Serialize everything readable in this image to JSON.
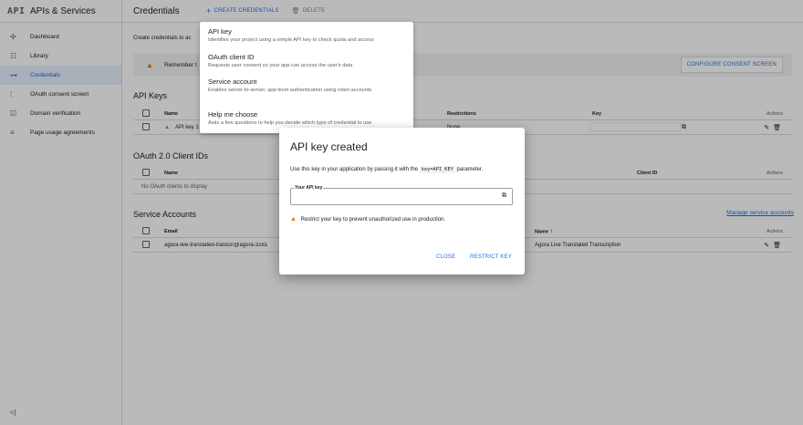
{
  "app": {
    "logo": "API",
    "title": "APIs & Services"
  },
  "sidebar": {
    "items": [
      {
        "label": "Dashboard",
        "icon": "dashboard-icon"
      },
      {
        "label": "Library",
        "icon": "library-icon"
      },
      {
        "label": "Credentials",
        "icon": "key-icon",
        "active": true
      },
      {
        "label": "OAuth consent screen",
        "icon": "consent-icon"
      },
      {
        "label": "Domain verification",
        "icon": "domain-icon"
      },
      {
        "label": "Page usage agreements",
        "icon": "settings-list-icon"
      }
    ],
    "collapse_glyph": "<|"
  },
  "header": {
    "title": "Credentials",
    "create_label": "CREATE CREDENTIALS",
    "delete_label": "DELETE"
  },
  "main": {
    "intro": "Create credentials to ac",
    "banner_text": "Remember t",
    "consent_button": "CONFIGURE CONSENT SCREEN",
    "api_keys": {
      "title": "API Keys",
      "columns": [
        "Name",
        "Restrictions",
        "Key",
        "Actions"
      ],
      "row_name": "API key 1",
      "row_restriction": "None"
    },
    "oauth": {
      "title": "OAuth 2.0 Client IDs",
      "columns": [
        "Name",
        "Client ID",
        "Actions"
      ],
      "empty": "No OAuth clients to display"
    },
    "service": {
      "title": "Service Accounts",
      "manage_link": "Manage service accounts",
      "columns": [
        "Email",
        "Name",
        "Actions"
      ],
      "row_email": "agora-live-translated-transcri@agora-3281",
      "row_name": "Agora Live Translated Transcription"
    }
  },
  "dropdown": {
    "items": [
      {
        "title": "API key",
        "desc": "Identifies your project using a simple API key to check quota and access"
      },
      {
        "title": "OAuth client ID",
        "desc": "Requests user consent so your app can access the user's data"
      },
      {
        "title": "Service account",
        "desc": "Enables server-to-server, app-level authentication using robot accounts"
      },
      {
        "title": "Help me choose",
        "desc": "Asks a few questions to help you decide which type of credential to use"
      }
    ]
  },
  "dialog": {
    "title": "API key created",
    "text_before": "Use this key in your application by passing it with the",
    "code": "key=API_KEY",
    "text_after": "parameter.",
    "field_label": "Your API key",
    "field_value": "",
    "warning": "Restrict your key to prevent unauthorized use in production.",
    "close_label": "CLOSE",
    "restrict_label": "RESTRICT KEY"
  },
  "colors": {
    "accent": "#1a73e8",
    "warning": "#e37400",
    "active_bg": "#e8f0fe"
  }
}
